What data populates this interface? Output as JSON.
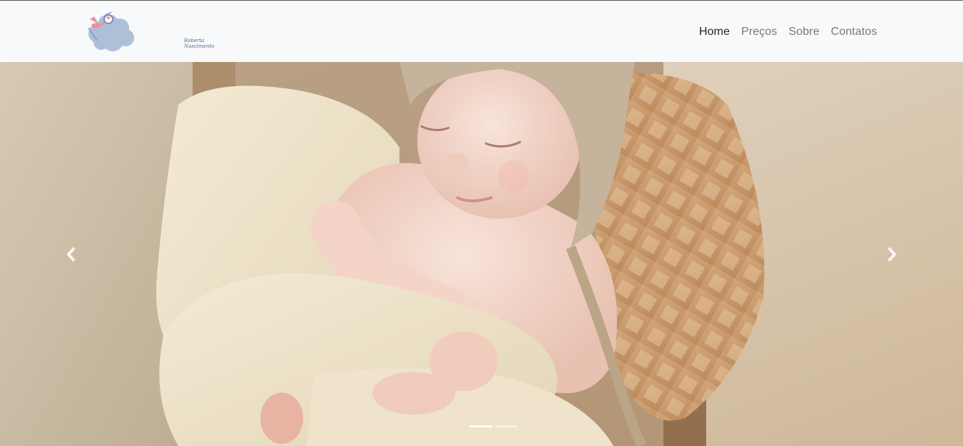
{
  "brand": {
    "logo_text": "Roberta Nascimento",
    "logo_icon": "stork-cloud-logo"
  },
  "nav": {
    "items": [
      {
        "label": "Home",
        "active": true
      },
      {
        "label": "Preços",
        "active": false
      },
      {
        "label": "Sobre",
        "active": false
      },
      {
        "label": "Contatos",
        "active": false
      }
    ]
  },
  "carousel": {
    "slide_count": 2,
    "active_index": 0,
    "prev_icon": "chevron-left-icon",
    "next_icon": "chevron-right-icon"
  },
  "colors": {
    "navbar_bg": "#f8f9fb",
    "nav_active": "#222222",
    "nav_inactive": "#777777",
    "logo_cloud": "#aebfd8",
    "logo_stork": "#e9919b"
  }
}
